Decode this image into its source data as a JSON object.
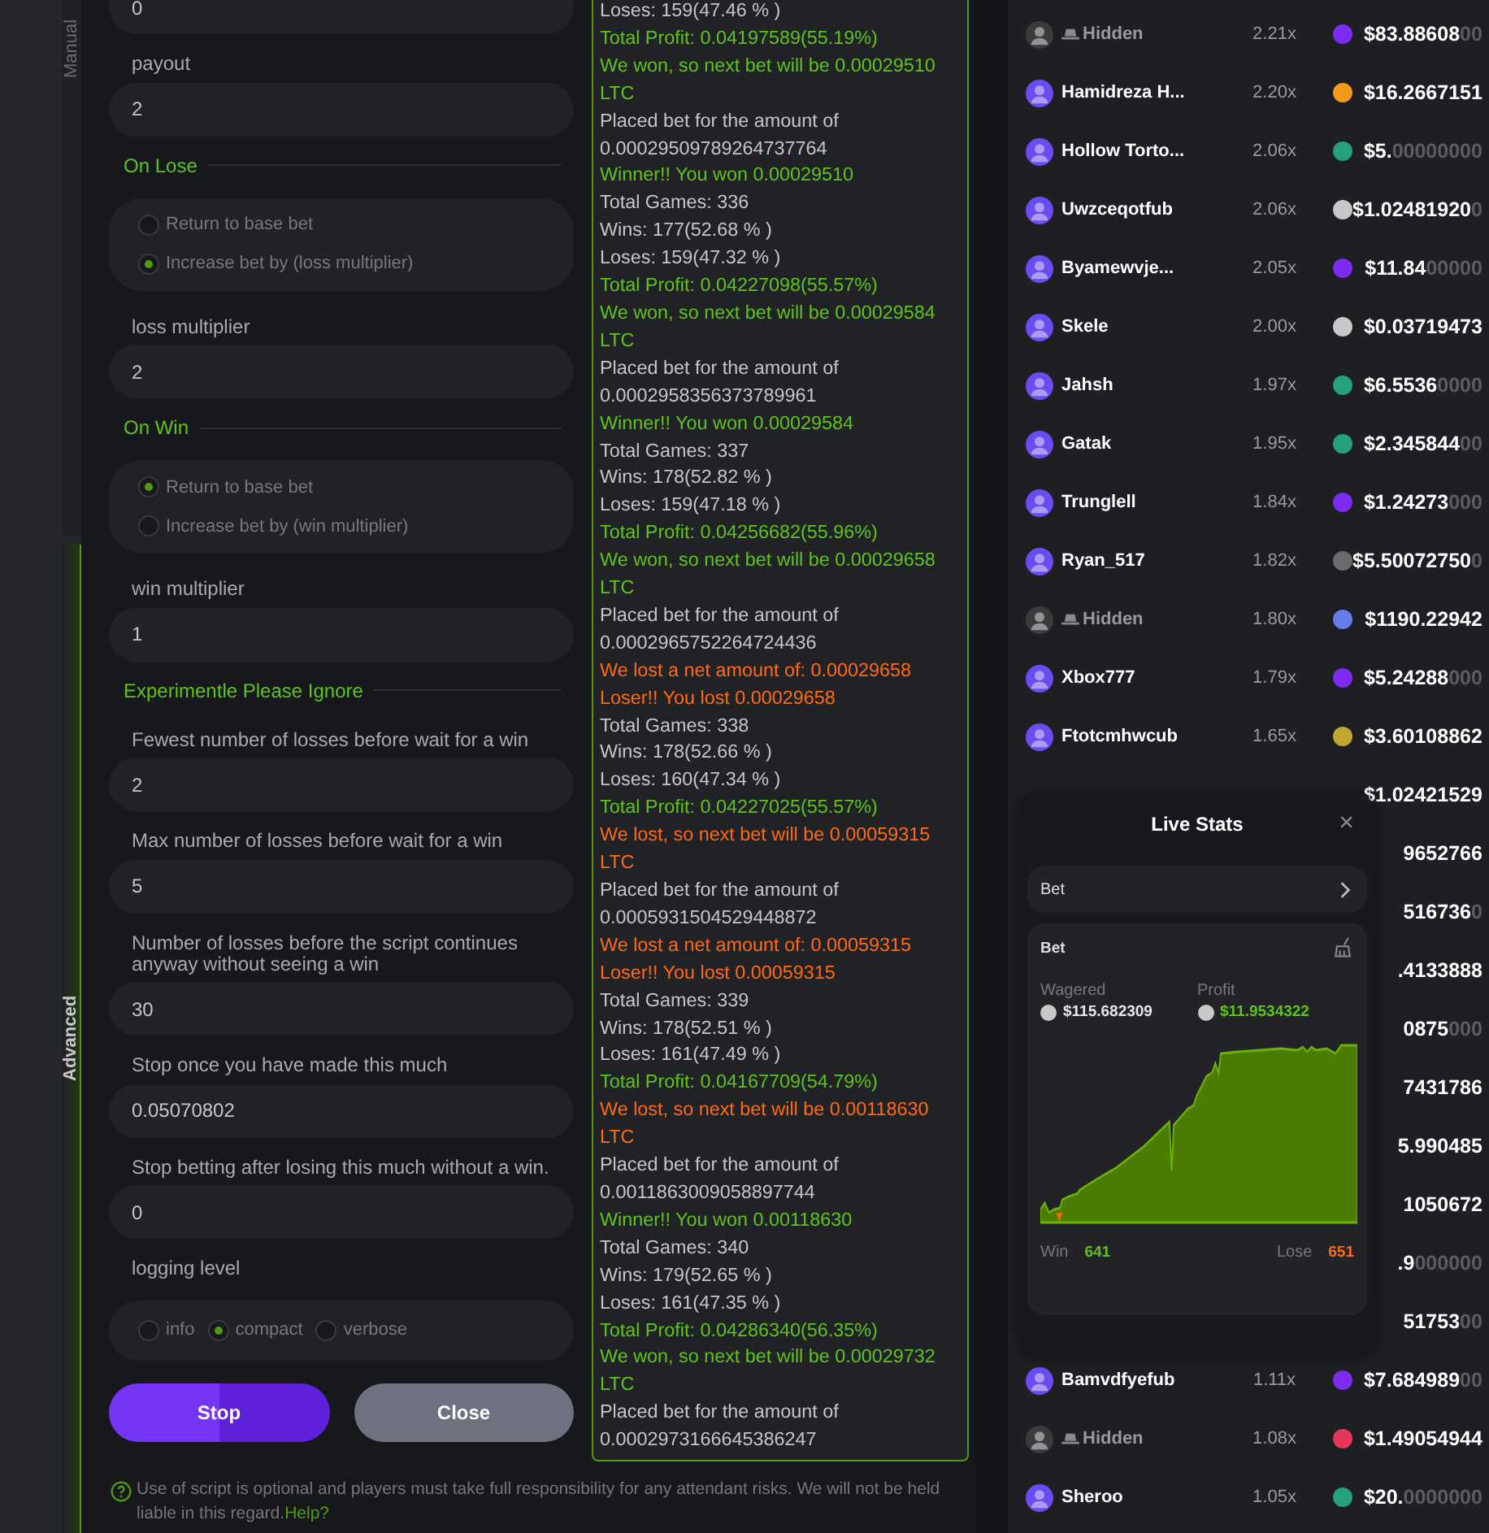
{
  "mode_tabs": [
    {
      "label": "Manual",
      "selected": false
    },
    {
      "label": "Advanced",
      "selected": true
    }
  ],
  "form": [
    {
      "kind": "field",
      "value": "0"
    },
    {
      "kind": "field",
      "label": "payout",
      "value": "2"
    },
    {
      "kind": "section",
      "title": "On Lose"
    },
    {
      "kind": "radio_column",
      "options": [
        {
          "label": "Return to base bet",
          "selected": false
        },
        {
          "label": "Increase bet by (loss multiplier)",
          "selected": true
        }
      ]
    },
    {
      "kind": "field",
      "label": "loss multiplier",
      "value": "2"
    },
    {
      "kind": "section",
      "title": "On Win"
    },
    {
      "kind": "radio_column",
      "options": [
        {
          "label": "Return to base bet",
          "selected": true
        },
        {
          "label": "Increase bet by (win multiplier)",
          "selected": false
        }
      ]
    },
    {
      "kind": "field",
      "label": "win multiplier",
      "value": "1"
    },
    {
      "kind": "section",
      "title": "Experimentle Please Ignore"
    },
    {
      "kind": "field",
      "label": "Fewest number of losses before wait for a win",
      "value": "2"
    },
    {
      "kind": "field",
      "label": "Max number of losses before wait for a win",
      "value": "5"
    },
    {
      "kind": "field",
      "label": "Number of losses before the script continues anyway without seeing a win",
      "value": "30"
    },
    {
      "kind": "field",
      "label": "Stop once you have made this much",
      "value": "0.05070802"
    },
    {
      "kind": "field",
      "label": "Stop betting after losing this much without a win.",
      "value": "0"
    },
    {
      "kind": "field_label",
      "label": "logging level"
    },
    {
      "kind": "radio_row",
      "options": [
        {
          "label": "info",
          "selected": false
        },
        {
          "label": "compact",
          "selected": true
        },
        {
          "label": "verbose",
          "selected": false
        }
      ]
    }
  ],
  "buttons": [
    {
      "label": "Stop",
      "kind": "primary"
    },
    {
      "label": "Close",
      "kind": "secondary"
    }
  ],
  "disclaimer": {
    "text": "Use of script is optional and players must take full responsibility for any attendant risks. We will not be held liable in this regard.",
    "link": "Help?"
  },
  "log": [
    {
      "kind": "info",
      "text": "Loses: 159(47.46 % )"
    },
    {
      "kind": "win",
      "text": "Total Profit: 0.04197589(55.19%)"
    },
    {
      "kind": "win",
      "text": "We won, so next bet will be 0.00029510 LTC"
    },
    {
      "kind": "info",
      "text": "Placed bet for the amount of 0.00029509789264737764"
    },
    {
      "kind": "win",
      "text": "Winner!! You won 0.00029510"
    },
    {
      "kind": "info",
      "text": "Total Games: 336"
    },
    {
      "kind": "info",
      "text": "Wins: 177(52.68 % )"
    },
    {
      "kind": "info",
      "text": "Loses: 159(47.32 % )"
    },
    {
      "kind": "win",
      "text": "Total Profit: 0.04227098(55.57%)"
    },
    {
      "kind": "win",
      "text": "We won, so next bet will be 0.00029584 LTC"
    },
    {
      "kind": "info",
      "text": "Placed bet for the amount of 0.0002958356373789961"
    },
    {
      "kind": "win",
      "text": "Winner!! You won 0.00029584"
    },
    {
      "kind": "info",
      "text": "Total Games: 337"
    },
    {
      "kind": "info",
      "text": "Wins: 178(52.82 % )"
    },
    {
      "kind": "info",
      "text": "Loses: 159(47.18 % )"
    },
    {
      "kind": "win",
      "text": "Total Profit: 0.04256682(55.96%)"
    },
    {
      "kind": "win",
      "text": "We won, so next bet will be 0.00029658 LTC"
    },
    {
      "kind": "info",
      "text": "Placed bet for the amount of 0.0002965752264724436"
    },
    {
      "kind": "loss",
      "text": "We lost a net amount of: 0.00029658"
    },
    {
      "kind": "loss",
      "text": "Loser!! You lost 0.00029658"
    },
    {
      "kind": "info",
      "text": "Total Games: 338"
    },
    {
      "kind": "info",
      "text": "Wins: 178(52.66 % )"
    },
    {
      "kind": "info",
      "text": "Loses: 160(47.34 % )"
    },
    {
      "kind": "win",
      "text": "Total Profit: 0.04227025(55.57%)"
    },
    {
      "kind": "loss",
      "text": "We lost, so next bet will be 0.00059315 LTC"
    },
    {
      "kind": "info",
      "text": "Placed bet for the amount of 0.0005931504529448872"
    },
    {
      "kind": "loss",
      "text": "We lost a net amount of: 0.00059315"
    },
    {
      "kind": "loss",
      "text": "Loser!! You lost 0.00059315"
    },
    {
      "kind": "info",
      "text": "Total Games: 339"
    },
    {
      "kind": "info",
      "text": "Wins: 178(52.51 % )"
    },
    {
      "kind": "info",
      "text": "Loses: 161(47.49 % )"
    },
    {
      "kind": "win",
      "text": "Total Profit: 0.04167709(54.79%)"
    },
    {
      "kind": "loss",
      "text": "We lost, so next bet will be 0.00118630 LTC"
    },
    {
      "kind": "info",
      "text": "Placed bet for the amount of 0.0011863009058897744"
    },
    {
      "kind": "win",
      "text": "Winner!! You won 0.00118630"
    },
    {
      "kind": "info",
      "text": "Total Games: 340"
    },
    {
      "kind": "info",
      "text": "Wins: 179(52.65 % )"
    },
    {
      "kind": "info",
      "text": "Loses: 161(47.35 % )"
    },
    {
      "kind": "win",
      "text": "Total Profit: 0.04286340(56.35%)"
    },
    {
      "kind": "win",
      "text": "We won, so next bet will be 0.00029732 LTC"
    },
    {
      "kind": "info",
      "text": "Placed bet for the amount of 0.0002973166645386247"
    }
  ],
  "bets": [
    {
      "name": "Hidden",
      "hidden": true,
      "multiplier": "2.21x",
      "color": "#7b2cf0",
      "amount": "$83.88608",
      "amount_dim": "00"
    },
    {
      "name": "Hamidreza H...",
      "hidden": false,
      "multiplier": "2.20x",
      "color": "#f39a1e",
      "amount": "$16.2667151"
    },
    {
      "name": "Hollow Torto...",
      "hidden": false,
      "multiplier": "2.06x",
      "color": "#26a17b",
      "amount": "$5.",
      "amount_dim": "00000000"
    },
    {
      "name": "Uwzceqotfub",
      "hidden": false,
      "multiplier": "2.06x",
      "color": "#c8c8c8",
      "amount": "$1.02481920",
      "amount_dim": "0"
    },
    {
      "name": "Byamewvje...",
      "hidden": false,
      "multiplier": "2.05x",
      "color": "#7b2cf0",
      "amount": "$11.84",
      "amount_dim": "00000"
    },
    {
      "name": "Skele",
      "hidden": false,
      "multiplier": "2.00x",
      "color": "#c8c8c8",
      "amount": "$0.03719473"
    },
    {
      "name": "Jahsh",
      "hidden": false,
      "multiplier": "1.97x",
      "color": "#26a17b",
      "amount": "$6.5536",
      "amount_dim": "0000"
    },
    {
      "name": "Gatak",
      "hidden": false,
      "multiplier": "1.95x",
      "color": "#26a17b",
      "amount": "$2.345844",
      "amount_dim": "00"
    },
    {
      "name": "Trunglell",
      "hidden": false,
      "multiplier": "1.84x",
      "color": "#7b2cf0",
      "amount": "$1.24273",
      "amount_dim": "000"
    },
    {
      "name": "Ryan_517",
      "hidden": false,
      "multiplier": "1.82x",
      "color": "#6b6b6b",
      "amount": "$5.50072750",
      "amount_dim": "0"
    },
    {
      "name": "Hidden",
      "hidden": true,
      "multiplier": "1.80x",
      "color": "#627eea",
      "amount": "$1190.22942"
    },
    {
      "name": "Xbox777",
      "hidden": false,
      "multiplier": "1.79x",
      "color": "#7b2cf0",
      "amount": "$5.24288",
      "amount_dim": "000"
    },
    {
      "name": "Ftotcmhwcub",
      "hidden": false,
      "multiplier": "1.65x",
      "color": "#c2a633",
      "amount": "$3.60108862"
    },
    {
      "amount": "$1.02421529"
    },
    {
      "amount": "9652766"
    },
    {
      "amount": "516736",
      "amount_dim": "0"
    },
    {
      "amount": ".4133888"
    },
    {
      "amount": "0875",
      "amount_dim": "000"
    },
    {
      "amount": "7431786"
    },
    {
      "amount": "5.990485"
    },
    {
      "amount": "1050672"
    },
    {
      "amount": ".9",
      "amount_dim": "000000"
    },
    {
      "amount": "51753",
      "amount_dim": "00"
    },
    {
      "name": "Bamvdfyefub",
      "hidden": false,
      "multiplier": "1.11x",
      "color": "#7b2cf0",
      "amount": "$7.684989",
      "amount_dim": "00"
    },
    {
      "name": "Hidden",
      "hidden": true,
      "multiplier": "1.08x",
      "color": "#e8365a",
      "amount": "$1.49054944"
    },
    {
      "name": "Sheroo",
      "hidden": false,
      "multiplier": "1.05x",
      "color": "#26a17b",
      "amount": "$20.",
      "amount_dim": "0000000"
    }
  ],
  "live_stats": {
    "title": "Live Stats",
    "close": "×",
    "selector": "Bet",
    "card_title": "Bet",
    "wagered_label": "Wagered",
    "wagered": "$115.682309",
    "profit_label": "Profit",
    "profit": "$11.9534322",
    "win_label": "Win",
    "wins": "641",
    "lose_label": "Lose",
    "losses": "651"
  }
}
